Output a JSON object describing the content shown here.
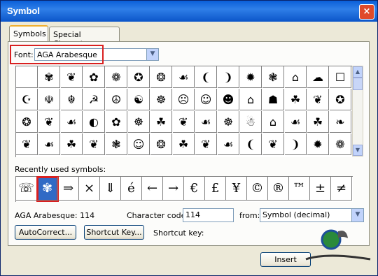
{
  "window": {
    "title": "Symbol",
    "close": "×"
  },
  "tabs": [
    {
      "label": "Symbols",
      "active": true
    },
    {
      "label": "Special Characters",
      "active": false
    }
  ],
  "font": {
    "label": "Font:",
    "value": "AGA Arabesque"
  },
  "grid_rows": [
    [
      "",
      "✾",
      "❦",
      "✿",
      "❁",
      "✪",
      "❂",
      "☙",
      "❨",
      "❩",
      "✹",
      "❃",
      "⌂",
      "☁",
      "☐"
    ],
    [
      "☪",
      "☫",
      "☬",
      "☭",
      "☮",
      "☯",
      "☸",
      "☹",
      "☺",
      "☻",
      "⌂",
      "☗",
      "☘",
      "❦",
      "✪"
    ],
    [
      "❂",
      "❦",
      "☙",
      "◐",
      "✿",
      "☸",
      "☘",
      "❦",
      "☙",
      "☸",
      "☃",
      "⌂",
      "☙",
      "☘",
      "❧"
    ],
    [
      "❦",
      "☙",
      "☘",
      "❦",
      "❃",
      "☺",
      "❂",
      "☘",
      "❦",
      "☙",
      "❨",
      "❦",
      "❩",
      "✹",
      "❁"
    ]
  ],
  "recent": {
    "label": "Recently used symbols:",
    "symbols": [
      "☏",
      "✾",
      "⇒",
      "×",
      "⇓",
      "é",
      "←",
      "→",
      "€",
      "£",
      "¥",
      "©",
      "®",
      "™",
      "±",
      "≠"
    ]
  },
  "info": {
    "symbol_name": "AGA Arabesque: 114",
    "char_code_label": "Character code:",
    "char_code": "114",
    "from_label": "from:",
    "from_value": "Symbol (decimal)",
    "shortcut_key_label": "Shortcut key:"
  },
  "buttons": {
    "autocorrect": "AutoCorrect...",
    "shortcut_key": "Shortcut Key...",
    "insert": "Insert"
  },
  "colors": {
    "titlebar": "#0a5fd8",
    "selection": "#316ac5",
    "highlight": "#d92020"
  }
}
